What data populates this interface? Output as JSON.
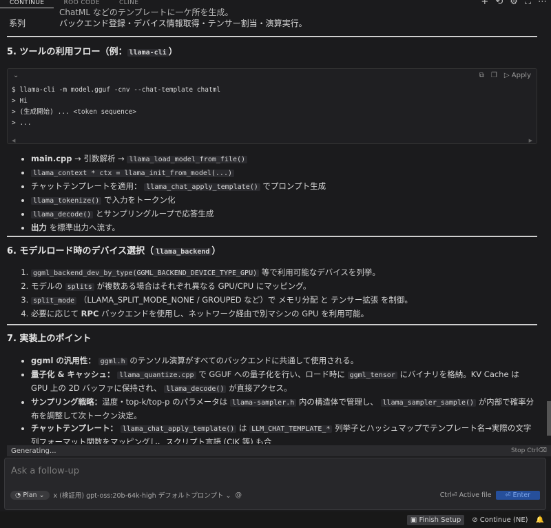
{
  "tabs": [
    {
      "label": "CONTINUE",
      "active": true
    },
    {
      "label": "ROO CODE",
      "active": false
    },
    {
      "label": "CLINE",
      "active": false
    }
  ],
  "top_icons": [
    "plus-icon",
    "history-icon",
    "gear-icon",
    "expand-icon",
    "more-icon"
  ],
  "top_rows": [
    {
      "key": "",
      "value": "ChatML などのテンプレートに一ケ所を生成。"
    },
    {
      "key": "系列",
      "value": "バックエンド登録・デバイス情報取得・テンサー割当・演算実行。"
    }
  ],
  "section5": {
    "title": "5. ツールの利用フロー（例：",
    "code": "llama-cli",
    "title_end": "）",
    "apply_label": "Apply",
    "code_lines": [
      "$ llama-cli -m model.gguf -cnv --chat-template chatml",
      "> Hi",
      "> (生成開始) ... <token sequence>",
      "> ..."
    ],
    "bullets": [
      {
        "pre": "",
        "strong": "main.cpp",
        "mid": " → 引数解析 → ",
        "code": "llama_load_model_from_file()",
        "post": ""
      },
      {
        "pre": "",
        "strong": "",
        "mid": "",
        "code": "llama_context * ctx = llama_init_from_model(...)",
        "post": ""
      },
      {
        "pre": "チャットテンプレートを適用：",
        "strong": "",
        "mid": "",
        "code": "llama_chat_apply_template()",
        "post": "でプロンプト生成"
      },
      {
        "pre": "",
        "strong": "",
        "mid": "",
        "code": "llama_tokenize()",
        "post": "で入力をトークン化"
      },
      {
        "pre": "",
        "strong": "",
        "mid": "",
        "code": "llama_decode()",
        "post": "とサンプリングループで応答生成"
      },
      {
        "pre": "",
        "strong": "出力",
        "mid": " を標準出力へ流す。",
        "code": "",
        "post": ""
      }
    ]
  },
  "section6": {
    "title": "6. モデルロード時のデバイス選択（",
    "code": "llama_backend",
    "title_end": "）",
    "items": [
      {
        "code": "ggml_backend_dev_by_type(GGML_BACKEND_DEVICE_TYPE_GPU)",
        "text": "等で利用可能なデバイスを列挙。"
      },
      {
        "pre": "モデルの",
        "code": "splits",
        "text": "が複数ある場合はそれぞれ異なる GPU/CPU にマッピング。"
      },
      {
        "code": "split_mode",
        "text": "（LLAMA_SPLIT_MODE_NONE / GROUPED など）で メモリ分配 と テンサー拡張 を制御。"
      },
      {
        "pre": "必要に応じて",
        "strong": "RPC",
        "text": "バックエンドを使用し、ネットワーク経由で別マシンの GPU を利用可能。"
      }
    ]
  },
  "section7": {
    "title": "7. 実装上のポイント",
    "items": [
      {
        "strong": "ggml の汎用性：",
        "code": "ggml.h",
        "text": "のテンソル演算がすべてのバックエンドに共通して使用される。"
      },
      {
        "strong": "量子化 & キャッシュ：",
        "code": "llama_quantize.cpp",
        "text": "で GGUF への量子化を行い、ロード時に",
        "code2": "ggml_tensor",
        "text2": "にバイナリを格納。KV Cache は GPU 上の 2D バッファに保持され、",
        "code3": "llama_decode()",
        "text3": "が直接アクセス。"
      },
      {
        "strong": "サンプリング戦略：",
        "text": "温度・top-k/top-p のパラメータは",
        "code": "llama-sampler.h",
        "text2": "内の構造体で管理し、",
        "code2": "llama_sampler_sample()",
        "text3": "が内部で確率分布を調整して次トークン決定。"
      },
      {
        "strong": "チャットテンプレート：",
        "code": "llama_chat_apply_template()",
        "text": "は",
        "code2": "LLM_CHAT_TEMPLATE_*",
        "text2": "列挙子とハッシュマップでテンプレート名→実際の文字列フォーマット関数をマッピングし、スクリプト言語 (CJK 等) も合"
      }
    ]
  },
  "status": {
    "label": "Generating...",
    "stop": "Stop Ctrl⌫"
  },
  "input": {
    "placeholder": "Ask a follow-up",
    "mode": "Plan",
    "model": "x (検証用) gpt-oss:20b-64k-high デフォルトプロンプト",
    "active_file": "Ctrl⏎ Active file",
    "enter": "⏎ Enter"
  },
  "footer": {
    "finish_setup": "Finish Setup",
    "continue_ne": "Continue (NE)"
  }
}
